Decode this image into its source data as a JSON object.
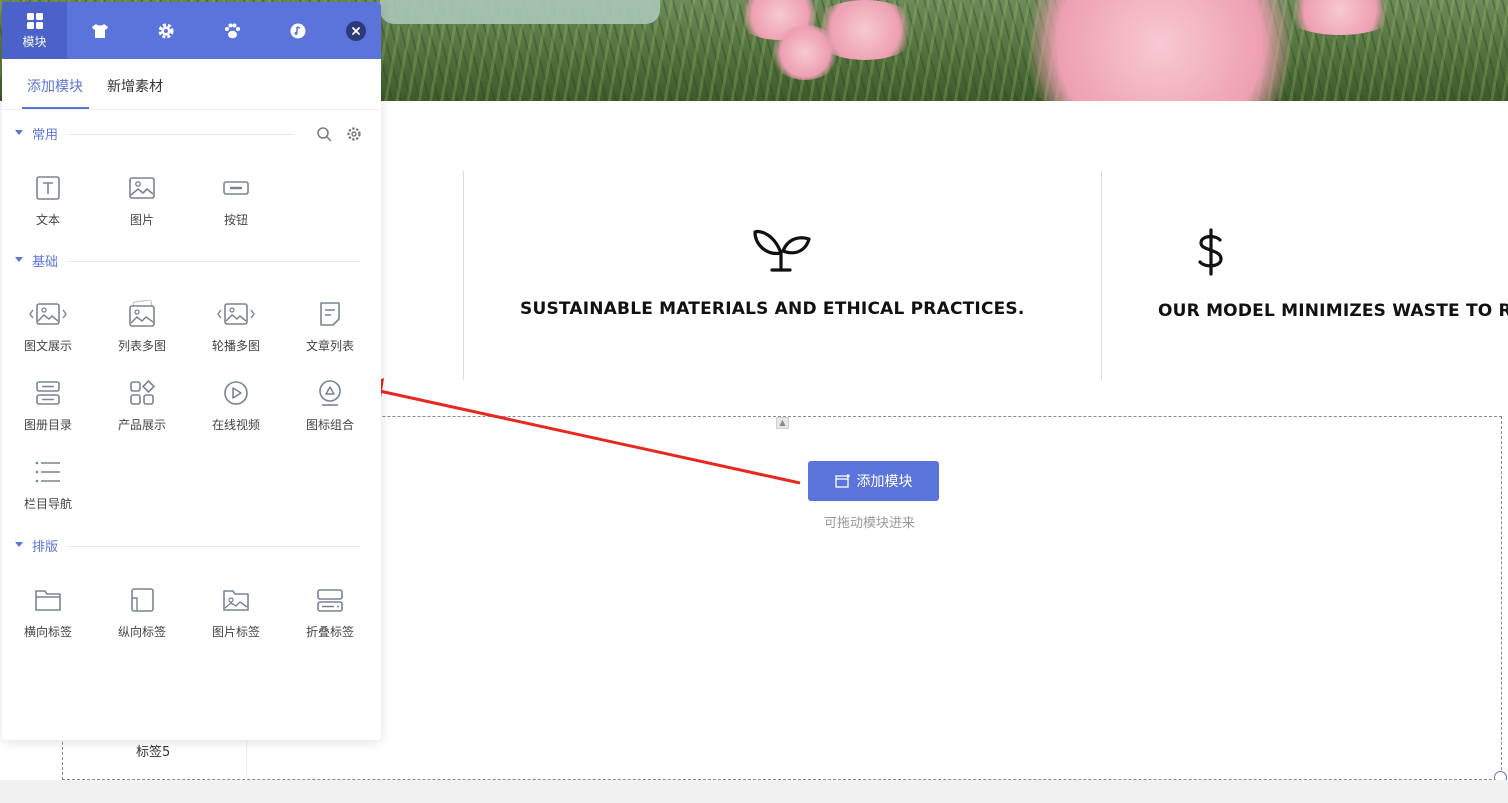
{
  "panel": {
    "top_tabs": [
      {
        "icon": "modules-grid-icon",
        "label": "模块",
        "active": true
      },
      {
        "icon": "shirt-icon",
        "label": ""
      },
      {
        "icon": "gear-icon",
        "label": ""
      },
      {
        "icon": "paw-icon",
        "label": ""
      },
      {
        "icon": "music-icon",
        "label": ""
      }
    ],
    "sub_tabs": [
      "添加模块",
      "新增素材"
    ],
    "sections": [
      {
        "title": "常用",
        "items": [
          {
            "label": "文本",
            "icon": "text-icon"
          },
          {
            "label": "图片",
            "icon": "image-icon"
          },
          {
            "label": "按钮",
            "icon": "button-icon"
          }
        ]
      },
      {
        "title": "基础",
        "items": [
          {
            "label": "图文展示",
            "icon": "image-text-icon"
          },
          {
            "label": "列表多图",
            "icon": "list-images-icon"
          },
          {
            "label": "轮播多图",
            "icon": "carousel-icon"
          },
          {
            "label": "文章列表",
            "icon": "article-list-icon"
          },
          {
            "label": "图册目录",
            "icon": "album-icon"
          },
          {
            "label": "产品展示",
            "icon": "product-icon"
          },
          {
            "label": "在线视频",
            "icon": "video-icon"
          },
          {
            "label": "图标组合",
            "icon": "icon-group-icon"
          },
          {
            "label": "栏目导航",
            "icon": "column-nav-icon"
          }
        ]
      },
      {
        "title": "排版",
        "items": [
          {
            "label": "横向标签",
            "icon": "horizontal-tab-icon"
          },
          {
            "label": "纵向标签",
            "icon": "vertical-tab-icon"
          },
          {
            "label": "图片标签",
            "icon": "image-tab-icon"
          },
          {
            "label": "折叠标签",
            "icon": "collapse-tab-icon"
          }
        ]
      }
    ]
  },
  "features": [
    {
      "title": "SUSTAINABLE MATERIALS AND ETHICAL PRACTICES.",
      "icon": "sprout-icon"
    },
    {
      "title": "OUR MODEL MINIMIZES WASTE TO RE",
      "icon": "dollar-icon"
    }
  ],
  "dropzone": {
    "add_button": "添加模块",
    "hint": "可拖动模块进来",
    "tab_label": "标签5"
  },
  "colors": {
    "accent": "#5b74dc",
    "arrow": "#e8271e"
  }
}
